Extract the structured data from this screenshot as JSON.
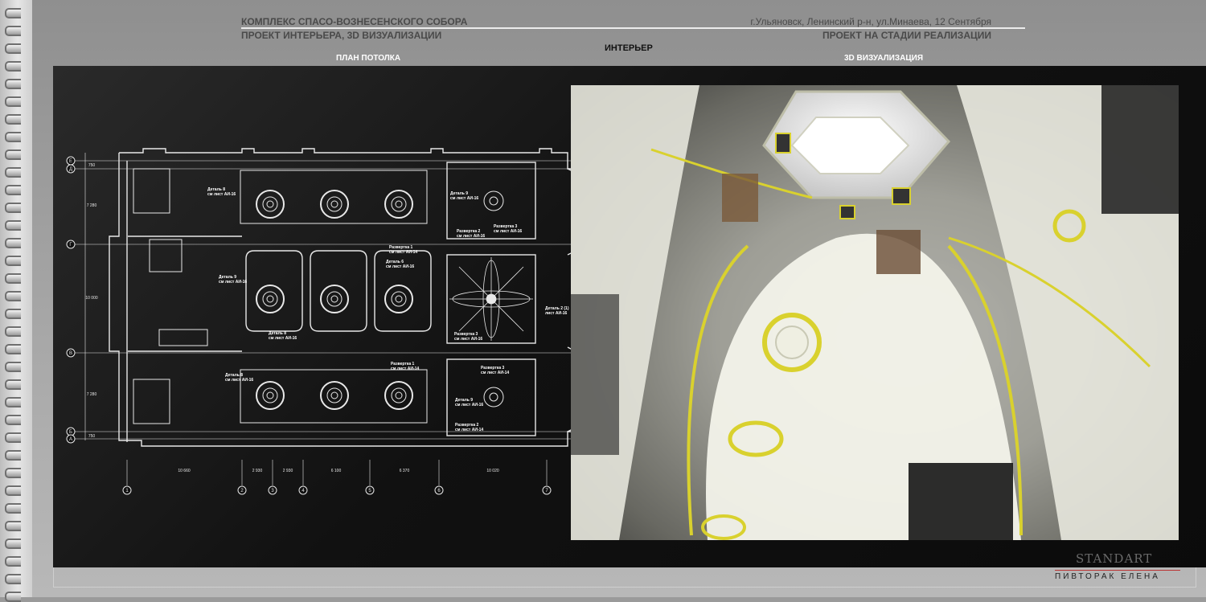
{
  "header": {
    "title_line1": "КОМПЛЕКС СПАСО-ВОЗНЕСЕНСКОГО СОБОРА",
    "title_line2": "ПРОЕКТ ИНТЕРЬЕРА, 3D ВИЗУАЛИЗАЦИИ",
    "address": "г.Ульяновск, Ленинский р-н, ул.Минаева, 12 Сентября",
    "status": "ПРОЕКТ НА СТАДИИ РЕАЛИЗАЦИИ"
  },
  "section_title": "ИНТЕРЬЕР",
  "left_label": "ПЛАН ПОТОЛКА",
  "right_label": "3D ВИЗУАЛИЗАЦИЯ",
  "plan": {
    "axes_rows": [
      "Е",
      "Д",
      "Г",
      "В",
      "Б",
      "А"
    ],
    "axes_cols": [
      "1",
      "2",
      "3",
      "4",
      "5",
      "6",
      "7"
    ],
    "col_dims": [
      "10 660",
      "2 930",
      "2 930",
      "6 100",
      "6 370",
      "10 020"
    ],
    "row_dims": [
      "750",
      "7 280",
      "10 000",
      "7 280",
      "750"
    ],
    "notes": {
      "d8_top": [
        "Деталь 8",
        "см лист АИ-16"
      ],
      "d9_top": [
        "Деталь 9",
        "см лист АИ-16"
      ],
      "r1_top": [
        "Развертка 1",
        "см лист АИ-14"
      ],
      "r2": [
        "Развертка 2",
        "см лист АИ-16"
      ],
      "r3_top": [
        "Развертка 3",
        "см лист АИ-16"
      ],
      "d9_mid": [
        "Деталь 9",
        "см лист АИ-16"
      ],
      "d8_mid": [
        "Деталь 8",
        "см лист АИ-16"
      ],
      "d6": [
        "Деталь 6",
        "см лист АИ-16"
      ],
      "r3_mid": [
        "Развертка 3",
        "см лист АИ-16"
      ],
      "d2": [
        "Деталь 2 (1)",
        "лист АИ-16"
      ],
      "d8_bot": [
        "Деталь 8",
        "см лист АИ-16"
      ],
      "r1_bot": [
        "Развертка 1",
        "см лист АИ-14"
      ],
      "r3_bot": [
        "Развертка 3",
        "см лист АИ-14"
      ],
      "d9_bot": [
        "Деталь 9",
        "см лист АИ-16"
      ],
      "r2_bot": [
        "Развертка 2",
        "см лист АИ-14"
      ]
    }
  },
  "branding": {
    "logo": "STANDART",
    "author": "ПИВТОРАК ЕЛЕНА"
  },
  "colors": {
    "panel": "#111111",
    "line": "#e8e8e8",
    "gold": "#d9d12e",
    "accent_red": "#b33333"
  }
}
